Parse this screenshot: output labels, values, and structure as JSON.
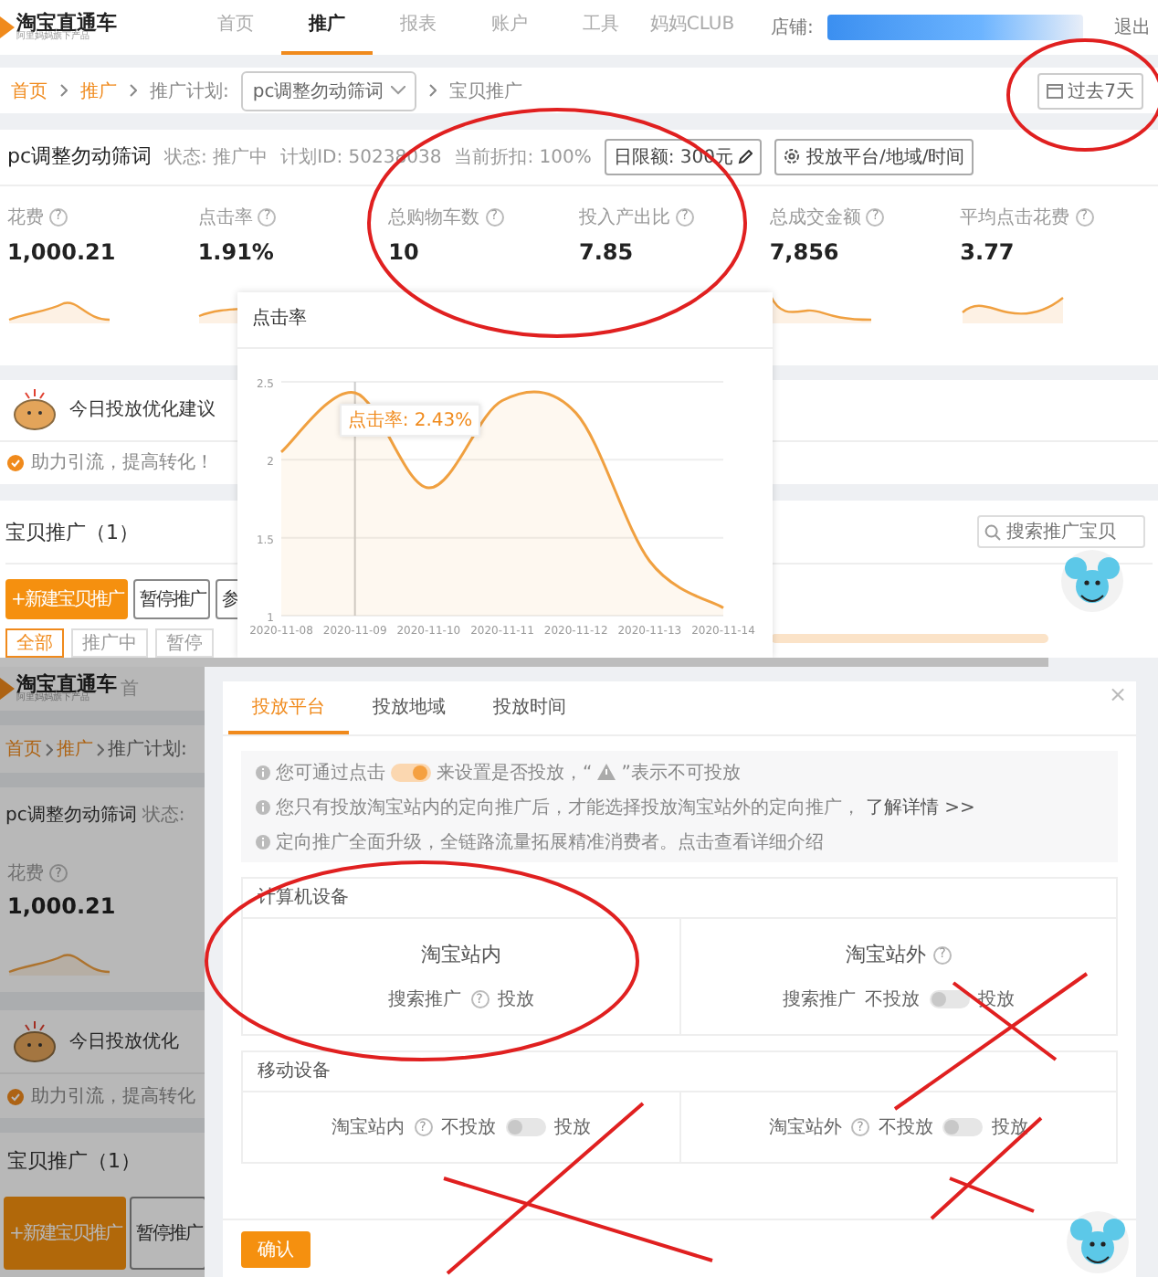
{
  "top": {
    "logo": {
      "name": "淘宝直通车",
      "tagline": "阿里妈妈旗下产品"
    },
    "nav": [
      {
        "label": "首页",
        "selected": false
      },
      {
        "label": "推广",
        "selected": true
      },
      {
        "label": "报表",
        "selected": false
      },
      {
        "label": "账户",
        "selected": false
      },
      {
        "label": "工具",
        "selected": false
      },
      {
        "label": "妈妈CLUB",
        "selected": false
      }
    ],
    "account": {
      "label": "店铺:",
      "logout": "退出"
    },
    "breadcrumb": {
      "links": [
        "首页",
        "推广"
      ],
      "plan_label": "推广计划:",
      "plan_select": "pc调整勿动筛词",
      "current": "宝贝推广"
    },
    "date_button": "过去7天",
    "plan": {
      "name": "pc调整勿动筛词",
      "fields": [
        "状态: 推广中",
        "计划ID: 50238038",
        "当前折扣: 100%"
      ],
      "budget_button": "日限额: 300元",
      "settings_button": "投放平台/地域/时间"
    },
    "metrics": [
      {
        "label": "花费",
        "help": "?",
        "value": "1,000.21"
      },
      {
        "label": "点击率",
        "help": "?",
        "value": "1.91%"
      },
      {
        "label": "总购物车数",
        "help": "?",
        "value": "10"
      },
      {
        "label": "投入产出比",
        "help": "?",
        "value": "7.85"
      },
      {
        "label": "总成交金额",
        "help": "?",
        "value": "7,856"
      },
      {
        "label": "平均点击花费",
        "help": "?",
        "value": "3.77"
      }
    ],
    "advice": "今日投放优化建议",
    "notice": "助力引流，提高转化！",
    "products": {
      "title": "宝贝推广（1）",
      "search_placeholder": "搜索推广宝贝",
      "buttons": [
        "+新建宝贝推广",
        "暂停推广",
        "参"
      ],
      "tabs": [
        {
          "label": "全部",
          "selected": true
        },
        {
          "label": "推广中",
          "selected": false
        },
        {
          "label": "暂停",
          "selected": false
        }
      ]
    },
    "chart_popup": {
      "chart_data": {
        "type": "area",
        "categories": [
          "2020-11-08",
          "2020-11-09",
          "2020-11-10",
          "2020-11-11",
          "2020-11-12",
          "2020-11-13",
          "2020-11-14"
        ],
        "series": [
          {
            "name": "点击率",
            "color": "#f0a040",
            "values": [
              2.05,
              2.43,
              1.82,
              2.38,
              2.3,
              1.35,
              1.05
            ]
          }
        ],
        "ylim": [
          1,
          2.5
        ],
        "yticks": [
          1,
          1.5,
          2,
          2.5
        ],
        "annotations": [
          {
            "x": "2020-11-09",
            "y": 2.43,
            "text": "点击率: 2.43%"
          }
        ],
        "ref_lines": [
          {
            "axis": "x",
            "value": "2020-11-09"
          }
        ]
      }
    }
  },
  "bottom": {
    "background": {
      "logo": {
        "name": "淘宝直通车",
        "tagline": "阿里妈妈旗下产品"
      },
      "nav": "首",
      "breadcrumb": [
        "首页",
        "推广",
        "推广计划:"
      ],
      "plan_name": "pc调整勿动筛词",
      "status": "状态:",
      "metric": {
        "label": "花费",
        "help": "?",
        "value": "1,000.21"
      },
      "advice": "今日投放优化",
      "notice": "助力引流，提高转化",
      "products_title": "宝贝推广（1）",
      "buttons": [
        "+新建宝贝推广",
        "暂停推广"
      ]
    },
    "dialog": {
      "close": "×",
      "tabs": [
        {
          "label": "投放平台",
          "selected": true
        },
        {
          "label": "投放地域",
          "selected": false
        },
        {
          "label": "投放时间",
          "selected": false
        }
      ],
      "hint": {
        "before": "您可通过点击",
        "toggle_on": true,
        "middle": "来设置是否投放，“",
        "after": "”表示不可投放"
      },
      "info": [
        {
          "text": "您只有投放淘宝站内的定向推广后，才能选择投放淘宝站外的定向推广，",
          "link": "了解详情 >>"
        },
        {
          "text": "定向推广全面升级，全链路流量拓展精准消费者。点击查看详细介绍"
        }
      ],
      "sections": [
        {
          "title": "计算机设备",
          "cells": [
            {
              "title": "淘宝站内",
              "row": {
                "kind": "fixed",
                "label": "搜索推广",
                "help": "?",
                "value": "投放"
              }
            },
            {
              "title": "淘宝站外",
              "title_help": "?",
              "row": {
                "kind": "switch",
                "label": "搜索推广",
                "off_label": "不投放",
                "on_label": "投放",
                "on": false
              }
            }
          ]
        },
        {
          "title": "移动设备",
          "cells": [
            {
              "row": {
                "kind": "switch",
                "label": "淘宝站内",
                "help": "?",
                "off_label": "不投放",
                "on_label": "投放",
                "on": false
              }
            },
            {
              "row": {
                "kind": "switch",
                "label": "淘宝站外",
                "help": "?",
                "off_label": "不投放",
                "on_label": "投放",
                "on": false
              }
            }
          ]
        }
      ],
      "confirm": "确认"
    }
  }
}
